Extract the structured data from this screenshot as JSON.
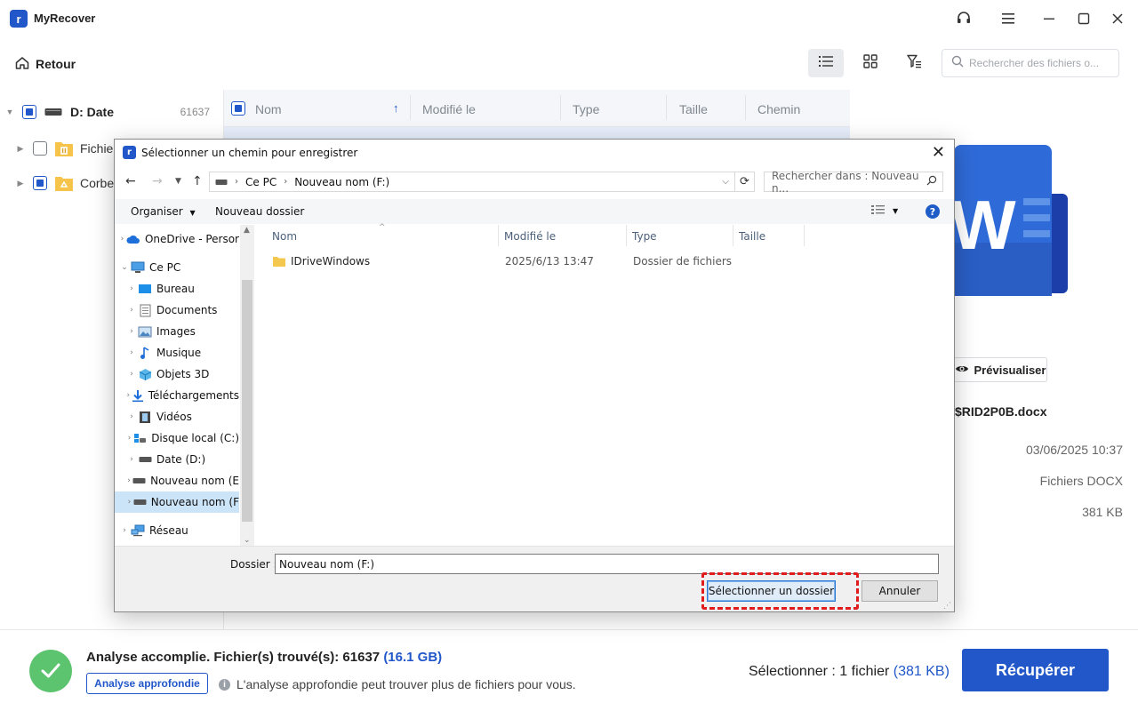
{
  "app": {
    "name": "MyRecover",
    "logo_letter": "r",
    "back_label": "Retour",
    "search_placeholder": "Rechercher des fichiers o..."
  },
  "tree": {
    "drive_label": "D: Date",
    "drive_count": "61637",
    "items": [
      {
        "label": "Fichier"
      },
      {
        "label": "Corbei"
      }
    ]
  },
  "columns": {
    "name": "Nom",
    "modified": "Modifié le",
    "type": "Type",
    "size": "Taille",
    "path": "Chemin"
  },
  "right_panel": {
    "preview_label": "Prévisualiser",
    "file_name": "$RID2P0B.docx",
    "date": "03/06/2025 10:37",
    "file_type": "Fichiers DOCX",
    "file_size": "381 KB",
    "word_letter": "W"
  },
  "bottom": {
    "scan_text": "Analyse accomplie. Fichier(s) trouvé(s): 61637",
    "scan_size": "(16.1 GB)",
    "deep_scan_label": "Analyse approfondie",
    "info_text": "L'analyse approfondie peut trouver plus de fichiers pour vous.",
    "selected_text": "Sélectionner : 1 fichier",
    "selected_size": "(381 KB)",
    "recover_label": "Récupérer"
  },
  "dialog": {
    "title": "Sélectionner un chemin pour enregistrer",
    "address": {
      "root": "Ce PC",
      "current": "Nouveau nom (F:)"
    },
    "search_placeholder": "Rechercher dans : Nouveau n...",
    "organize_label": "Organiser",
    "new_folder_label": "Nouveau dossier",
    "nav_items": [
      {
        "label": "OneDrive - Persor",
        "icon": "cloud-icon"
      },
      {
        "label": "Ce PC",
        "icon": "computer-icon"
      },
      {
        "label": "Bureau",
        "icon": "desktop-icon"
      },
      {
        "label": "Documents",
        "icon": "documents-icon"
      },
      {
        "label": "Images",
        "icon": "images-icon"
      },
      {
        "label": "Musique",
        "icon": "music-icon"
      },
      {
        "label": "Objets 3D",
        "icon": "objects3d-icon"
      },
      {
        "label": "Téléchargements",
        "icon": "download-icon"
      },
      {
        "label": "Vidéos",
        "icon": "videos-icon"
      },
      {
        "label": "Disque local (C:)",
        "icon": "local-disk-icon"
      },
      {
        "label": "Date (D:)",
        "icon": "drive-icon"
      },
      {
        "label": "Nouveau nom (E",
        "icon": "drive-icon"
      },
      {
        "label": "Nouveau nom (F",
        "icon": "drive-icon"
      },
      {
        "label": "Réseau",
        "icon": "network-icon"
      }
    ],
    "file_columns": {
      "name": "Nom",
      "modified": "Modifié le",
      "type": "Type",
      "size": "Taille"
    },
    "files": [
      {
        "name": "IDriveWindows",
        "modified": "2025/6/13 13:47",
        "type": "Dossier de fichiers",
        "size": ""
      }
    ],
    "folder_label": "Dossier :",
    "folder_value": "Nouveau nom (F:)",
    "select_button": "Sélectionner un dossier",
    "cancel_button": "Annuler"
  },
  "colors": {
    "accent": "#2157c9",
    "success": "#5cc36e",
    "highlight": "#e11c1c"
  }
}
